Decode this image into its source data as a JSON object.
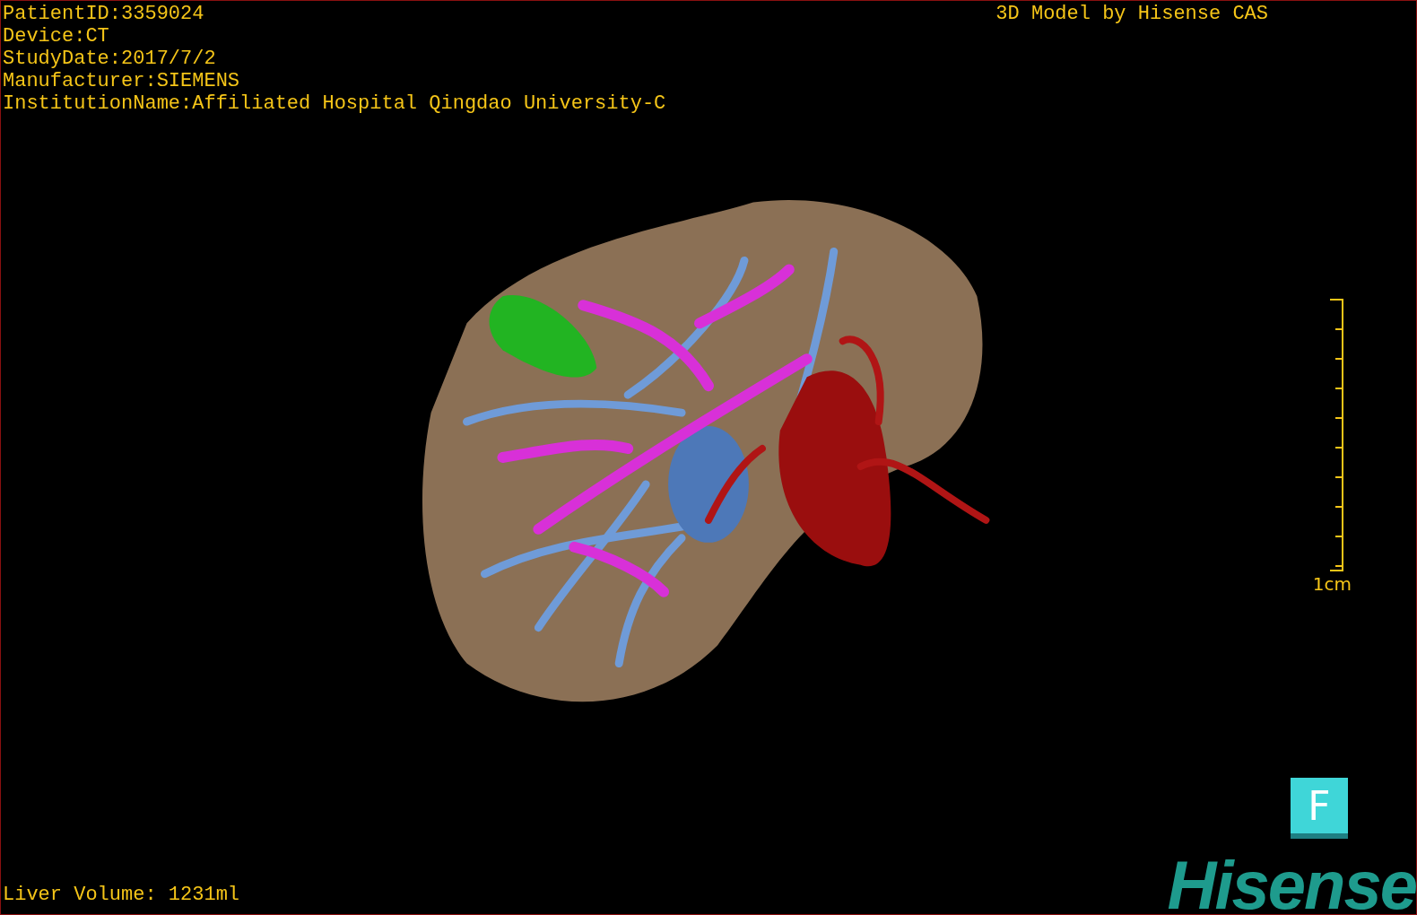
{
  "info_lines": [
    "PatientID:3359024",
    "Device:CT",
    "StudyDate:2017/7/2",
    "Manufacturer:SIEMENS",
    "InstitutionName:Affiliated Hospital Qingdao University-C"
  ],
  "title": "3D Model by Hisense CAS",
  "scale_bar": {
    "label": "1cm"
  },
  "view_button": {
    "label": "F"
  },
  "logo": {
    "text": "Hisense"
  },
  "status": "Liver Volume: 1231ml"
}
